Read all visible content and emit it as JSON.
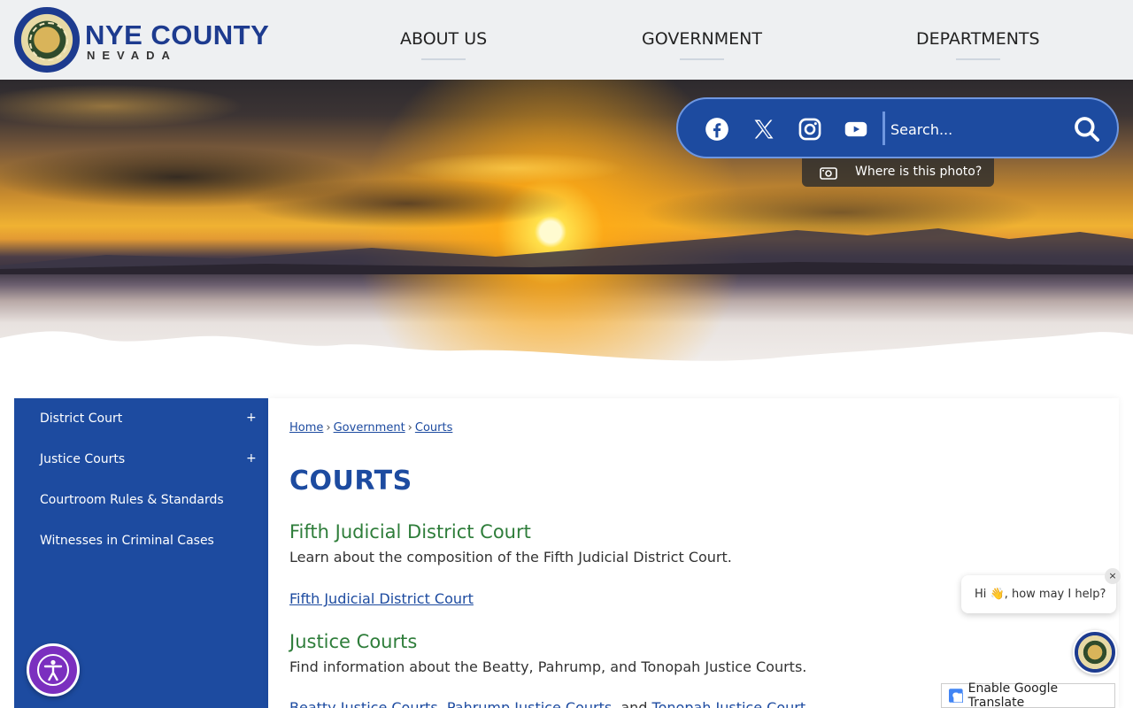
{
  "header": {
    "logo_title": "NYE COUNTY",
    "logo_sub": "NEVADA",
    "nav": [
      "ABOUT US",
      "GOVERNMENT",
      "DEPARTMENTS"
    ]
  },
  "social": {
    "icons": [
      "facebook-icon",
      "x-twitter-icon",
      "instagram-icon",
      "youtube-icon"
    ],
    "search_placeholder": "Search..."
  },
  "photo_tag": "Where is this photo?",
  "sidebar": {
    "items": [
      {
        "label": "District Court",
        "expand": "+"
      },
      {
        "label": "Justice Courts",
        "expand": "+"
      },
      {
        "label": "Courtroom Rules & Standards"
      },
      {
        "label": "Witnesses in Criminal Cases"
      }
    ]
  },
  "breadcrumb": [
    "Home",
    "Government",
    "Courts"
  ],
  "breadcrumb_sep": "›",
  "main": {
    "title": "COURTS",
    "sections": [
      {
        "heading": "Fifth Judicial District Court",
        "description": "Learn about the composition of the Fifth Judicial District Court.",
        "link": "Fifth Judicial District Court"
      },
      {
        "heading": "Justice Courts",
        "description": "Find information about the Beatty, Pahrump, and Tonopah Justice Courts.",
        "links": [
          "Beatty Justice Courts",
          "Pahrump Justice Courts",
          "Tonopah Justice Court"
        ],
        "sep1": ", ",
        "sep2": ", and "
      }
    ]
  },
  "chat": {
    "greeting": "Hi 👋, how may I help?",
    "close": "×"
  },
  "translate": "Enable Google Translate",
  "colors": {
    "brand_blue": "#1d4ba0",
    "heading_green": "#2e7d3a",
    "accessibility_purple": "#7b2fbf"
  }
}
